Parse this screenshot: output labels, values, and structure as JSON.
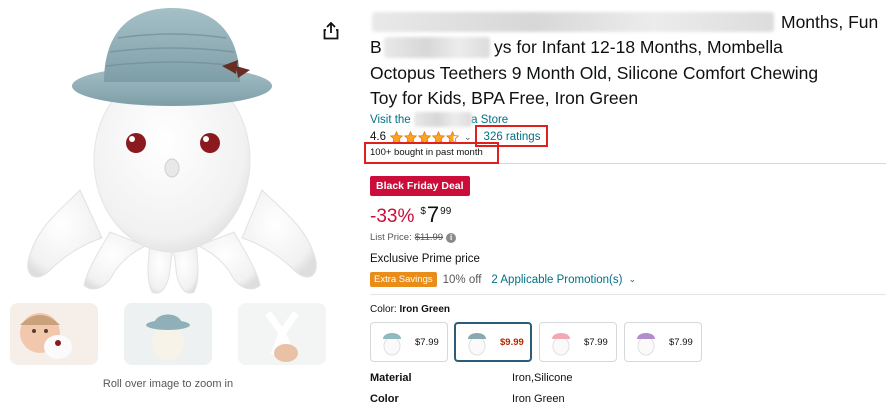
{
  "product": {
    "title_lines": [
      "Months, Fun",
      "ys for Infant 12-18 Months, Mombella",
      "Octopus Teethers 9 Month Old, Silicone Comfort Chewing",
      "Toy for Kids, BPA Free, Iron Green"
    ],
    "title_line2_prefix": "B",
    "store_prefix": "Visit the",
    "store_suffix": "a Store",
    "rating_value": "4.6",
    "rating_stars": 4.6,
    "ratings_count": "326 ratings",
    "bought_text": "100+ bought in past month",
    "deal_badge": "Black Friday Deal",
    "discount": "-33%",
    "price_symbol": "$",
    "price_whole": "7",
    "price_fraction": "99",
    "list_price_label": "List Price:",
    "list_price_value": "$11.99",
    "prime_text": "Exclusive Prime price",
    "extra_savings_label": "Extra Savings",
    "extra_savings_pct": "10% off",
    "promotions_link": "2 Applicable Promotion(s)",
    "color_label": "Color:",
    "color_value": "Iron Green",
    "swatches": [
      {
        "price": "$7.99",
        "hat_color": "#8fb9bf",
        "selected": false
      },
      {
        "price": "$9.99",
        "hat_color": "#8aa8b0",
        "selected": true
      },
      {
        "price": "$7.99",
        "hat_color": "#f2a9b3",
        "selected": false
      },
      {
        "price": "$7.99",
        "hat_color": "#b38ccf",
        "selected": false
      }
    ],
    "specs": [
      {
        "key": "Material",
        "value": "Iron,Silicone"
      },
      {
        "key": "Color",
        "value": "Iron Green"
      }
    ]
  },
  "gallery": {
    "zoom_hint": "Roll over image to zoom in",
    "hat_color": "#8aa9b1",
    "body_color": "#ffffff"
  },
  "colors": {
    "link": "#007185",
    "deal_red": "#cc0c39",
    "star": "#ffa41c",
    "highlight_box": "#e0201c",
    "extra_savings": "#e88d1a"
  },
  "icons": [
    "share-icon",
    "star-icon",
    "chevron-down-icon",
    "info-icon"
  ]
}
